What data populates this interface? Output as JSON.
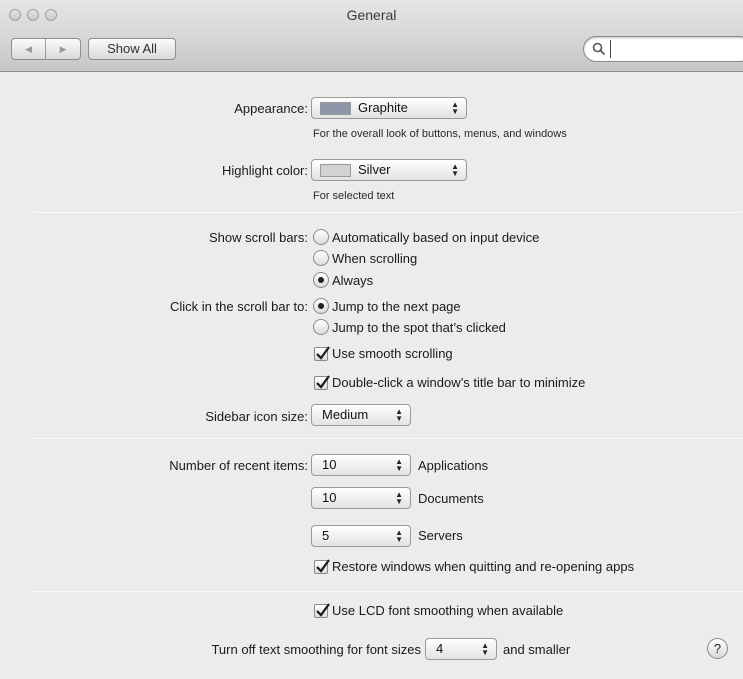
{
  "window": {
    "title": "General"
  },
  "toolbar": {
    "show_all": "Show All",
    "search": {
      "value": "",
      "placeholder": ""
    }
  },
  "appearance": {
    "label": "Appearance:",
    "value": "Graphite",
    "swatch_color": "#8d97a8",
    "note": "For the overall look of buttons, menus, and windows"
  },
  "highlight": {
    "label": "Highlight color:",
    "value": "Silver",
    "swatch_color": "#d2d2d2",
    "note": "For selected text"
  },
  "scrollbars": {
    "label": "Show scroll bars:",
    "options": [
      {
        "label": "Automatically based on input device",
        "selected": false
      },
      {
        "label": "When scrolling",
        "selected": false
      },
      {
        "label": "Always",
        "selected": true
      }
    ]
  },
  "click_scroll": {
    "label": "Click in the scroll bar to:",
    "options": [
      {
        "label": "Jump to the next page",
        "selected": true
      },
      {
        "label": "Jump to the spot that’s clicked",
        "selected": false
      }
    ]
  },
  "checks": {
    "smooth_scrolling": {
      "label": "Use smooth scrolling",
      "checked": true
    },
    "double_click": {
      "label": "Double-click a window’s title bar to minimize",
      "checked": true
    },
    "restore_windows": {
      "label": "Restore windows when quitting and re-opening apps",
      "checked": true
    },
    "lcd_smoothing": {
      "label": "Use LCD font smoothing when available",
      "checked": true
    }
  },
  "sidebar": {
    "label": "Sidebar icon size:",
    "value": "Medium"
  },
  "recent": {
    "label": "Number of recent items:",
    "applications": {
      "value": "10",
      "label": "Applications"
    },
    "documents": {
      "value": "10",
      "label": "Documents"
    },
    "servers": {
      "value": "5",
      "label": "Servers"
    }
  },
  "text_smoothing": {
    "prefix": "Turn off text smoothing for font sizes",
    "value": "4",
    "suffix": "and smaller"
  },
  "help": {
    "label": "?"
  }
}
